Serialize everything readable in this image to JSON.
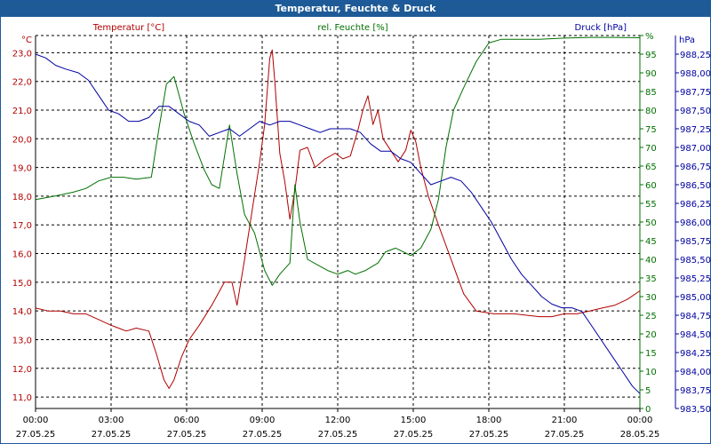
{
  "window": {
    "title": "Temperatur, Feuchte & Druck"
  },
  "chart_data": {
    "type": "line",
    "title": "Temperatur, Feuchte & Druck",
    "x_ticks": [
      {
        "time": "00:00",
        "date": "27.05.25"
      },
      {
        "time": "03:00",
        "date": "27.05.25"
      },
      {
        "time": "06:00",
        "date": "27.05.25"
      },
      {
        "time": "09:00",
        "date": "27.05.25"
      },
      {
        "time": "12:00",
        "date": "27.05.25"
      },
      {
        "time": "15:00",
        "date": "27.05.25"
      },
      {
        "time": "18:00",
        "date": "27.05.25"
      },
      {
        "time": "21:00",
        "date": "27.05.25"
      },
      {
        "time": "00:00",
        "date": "28.05.25"
      }
    ],
    "xlim_hours": [
      0,
      24
    ],
    "grid": true,
    "axes": {
      "temperature": {
        "unit": "°C",
        "ylim": [
          10.6,
          23.6
        ],
        "ticks": [
          "11,0",
          "12,0",
          "13,0",
          "14,0",
          "15,0",
          "16,0",
          "17,0",
          "18,0",
          "19,0",
          "20,0",
          "21,0",
          "22,0",
          "23,0"
        ],
        "tick_values": [
          11,
          12,
          13,
          14,
          15,
          16,
          17,
          18,
          19,
          20,
          21,
          22,
          23
        ],
        "color": "#b00000"
      },
      "humidity": {
        "unit": "%",
        "ylim": [
          0,
          100
        ],
        "ticks": [
          "0",
          "5",
          "10",
          "15",
          "20",
          "25",
          "30",
          "35",
          "40",
          "45",
          "50",
          "55",
          "60",
          "65",
          "70",
          "75",
          "80",
          "85",
          "90",
          "95",
          "%"
        ],
        "tick_values": [
          0,
          5,
          10,
          15,
          20,
          25,
          30,
          35,
          40,
          45,
          50,
          55,
          60,
          65,
          70,
          75,
          80,
          85,
          90,
          95,
          100
        ],
        "color": "#007000"
      },
      "pressure": {
        "unit": "hPa",
        "ylim": [
          983.5,
          988.5
        ],
        "ticks": [
          "983,50",
          "983,75",
          "984,00",
          "984,25",
          "984,50",
          "984,75",
          "985,00",
          "985,25",
          "985,50",
          "985,75",
          "986,00",
          "986,25",
          "986,50",
          "986,75",
          "987,00",
          "987,25",
          "987,50",
          "987,75",
          "988,00",
          "988,25"
        ],
        "tick_values": [
          983.5,
          983.75,
          984,
          984.25,
          984.5,
          984.75,
          985,
          985.25,
          985.5,
          985.75,
          986,
          986.25,
          986.5,
          986.75,
          987,
          987.25,
          987.5,
          987.75,
          988,
          988.25
        ],
        "color": "#0000a0"
      }
    },
    "series": [
      {
        "name": "Temperatur [°C]",
        "axis": "temperature",
        "color": "#b00000",
        "points": [
          [
            0,
            14.1
          ],
          [
            0.5,
            14.0
          ],
          [
            1,
            14.0
          ],
          [
            1.5,
            13.9
          ],
          [
            2,
            13.9
          ],
          [
            2.5,
            13.7
          ],
          [
            3,
            13.5
          ],
          [
            3.3,
            13.4
          ],
          [
            3.6,
            13.3
          ],
          [
            4,
            13.4
          ],
          [
            4.5,
            13.3
          ],
          [
            4.8,
            12.5
          ],
          [
            5.1,
            11.6
          ],
          [
            5.3,
            11.3
          ],
          [
            5.5,
            11.6
          ],
          [
            5.8,
            12.4
          ],
          [
            6.1,
            13.0
          ],
          [
            6.5,
            13.5
          ],
          [
            7,
            14.2
          ],
          [
            7.5,
            15.0
          ],
          [
            7.8,
            15.0
          ],
          [
            8.0,
            14.2
          ],
          [
            8.3,
            15.8
          ],
          [
            8.6,
            17.5
          ],
          [
            8.9,
            19.2
          ],
          [
            9.1,
            20.5
          ],
          [
            9.3,
            22.8
          ],
          [
            9.4,
            23.1
          ],
          [
            9.5,
            22.0
          ],
          [
            9.7,
            19.5
          ],
          [
            9.9,
            18.5
          ],
          [
            10.1,
            17.2
          ],
          [
            10.3,
            18.2
          ],
          [
            10.5,
            19.6
          ],
          [
            10.8,
            19.7
          ],
          [
            11.1,
            19.0
          ],
          [
            11.5,
            19.3
          ],
          [
            11.9,
            19.5
          ],
          [
            12.2,
            19.3
          ],
          [
            12.5,
            19.4
          ],
          [
            12.8,
            20.3
          ],
          [
            13.0,
            21.0
          ],
          [
            13.2,
            21.5
          ],
          [
            13.4,
            20.5
          ],
          [
            13.6,
            21.0
          ],
          [
            13.8,
            20.0
          ],
          [
            14.1,
            19.6
          ],
          [
            14.4,
            19.2
          ],
          [
            14.7,
            19.6
          ],
          [
            14.9,
            20.3
          ],
          [
            15.1,
            19.9
          ],
          [
            15.3,
            19.0
          ],
          [
            15.6,
            18.0
          ],
          [
            16.0,
            17.0
          ],
          [
            16.5,
            15.8
          ],
          [
            17.0,
            14.6
          ],
          [
            17.5,
            14.0
          ],
          [
            18.2,
            13.9
          ],
          [
            19,
            13.9
          ],
          [
            20,
            13.8
          ],
          [
            20.5,
            13.8
          ],
          [
            21,
            13.9
          ],
          [
            21.5,
            13.9
          ],
          [
            22,
            14.0
          ],
          [
            22.5,
            14.1
          ],
          [
            23,
            14.2
          ],
          [
            23.5,
            14.4
          ],
          [
            24,
            14.7
          ]
        ]
      },
      {
        "name": "rel. Feuchte [%]",
        "axis": "humidity",
        "color": "#007000",
        "points": [
          [
            0,
            56
          ],
          [
            0.8,
            57
          ],
          [
            1.5,
            58
          ],
          [
            2.0,
            59
          ],
          [
            2.5,
            61
          ],
          [
            3.0,
            62
          ],
          [
            3.5,
            62
          ],
          [
            4.0,
            61.5
          ],
          [
            4.6,
            62
          ],
          [
            4.9,
            75
          ],
          [
            5.2,
            87
          ],
          [
            5.5,
            89
          ],
          [
            5.9,
            79
          ],
          [
            6.3,
            71
          ],
          [
            6.7,
            64
          ],
          [
            7.0,
            60
          ],
          [
            7.3,
            59
          ],
          [
            7.7,
            76
          ],
          [
            8.0,
            63
          ],
          [
            8.3,
            52
          ],
          [
            8.7,
            47
          ],
          [
            9.1,
            37
          ],
          [
            9.4,
            33
          ],
          [
            9.7,
            36
          ],
          [
            10.1,
            39
          ],
          [
            10.3,
            60
          ],
          [
            10.5,
            50
          ],
          [
            10.8,
            40
          ],
          [
            11.2,
            38.5
          ],
          [
            11.6,
            37
          ],
          [
            12.0,
            36
          ],
          [
            12.4,
            37
          ],
          [
            12.7,
            36
          ],
          [
            13.1,
            37
          ],
          [
            13.6,
            39
          ],
          [
            13.9,
            42
          ],
          [
            14.3,
            43
          ],
          [
            14.6,
            42
          ],
          [
            14.9,
            41
          ],
          [
            15.3,
            43
          ],
          [
            15.7,
            48
          ],
          [
            16.0,
            56
          ],
          [
            16.3,
            70
          ],
          [
            16.6,
            80
          ],
          [
            17.0,
            86
          ],
          [
            17.5,
            93
          ],
          [
            18,
            98
          ],
          [
            18.5,
            99
          ],
          [
            19,
            99
          ],
          [
            20,
            99
          ],
          [
            21,
            99.3
          ],
          [
            22,
            99.5
          ],
          [
            23,
            99.5
          ],
          [
            24,
            99.4
          ]
        ]
      },
      {
        "name": "Druck [hPa]",
        "axis": "pressure",
        "color": "#0000a0",
        "points": [
          [
            0,
            988.25
          ],
          [
            0.4,
            988.2
          ],
          [
            0.8,
            988.1
          ],
          [
            1.2,
            988.05
          ],
          [
            1.7,
            988.0
          ],
          [
            2.1,
            987.9
          ],
          [
            2.5,
            987.7
          ],
          [
            2.9,
            987.5
          ],
          [
            3.3,
            987.45
          ],
          [
            3.7,
            987.35
          ],
          [
            4.1,
            987.35
          ],
          [
            4.5,
            987.4
          ],
          [
            4.9,
            987.55
          ],
          [
            5.3,
            987.55
          ],
          [
            5.7,
            987.45
          ],
          [
            6.1,
            987.35
          ],
          [
            6.5,
            987.3
          ],
          [
            6.9,
            987.15
          ],
          [
            7.3,
            987.2
          ],
          [
            7.7,
            987.25
          ],
          [
            8.1,
            987.15
          ],
          [
            8.5,
            987.25
          ],
          [
            8.9,
            987.35
          ],
          [
            9.3,
            987.3
          ],
          [
            9.7,
            987.35
          ],
          [
            10.1,
            987.35
          ],
          [
            10.5,
            987.3
          ],
          [
            10.9,
            987.25
          ],
          [
            11.3,
            987.2
          ],
          [
            11.7,
            987.25
          ],
          [
            12.1,
            987.25
          ],
          [
            12.5,
            987.25
          ],
          [
            12.9,
            987.2
          ],
          [
            13.3,
            987.05
          ],
          [
            13.7,
            986.95
          ],
          [
            14.1,
            986.95
          ],
          [
            14.5,
            986.85
          ],
          [
            14.9,
            986.8
          ],
          [
            15.3,
            986.65
          ],
          [
            15.7,
            986.5
          ],
          [
            16.1,
            986.55
          ],
          [
            16.5,
            986.6
          ],
          [
            16.9,
            986.55
          ],
          [
            17.3,
            986.4
          ],
          [
            17.7,
            986.2
          ],
          [
            18.1,
            986.0
          ],
          [
            18.5,
            985.75
          ],
          [
            18.9,
            985.5
          ],
          [
            19.3,
            985.3
          ],
          [
            19.7,
            985.15
          ],
          [
            20.1,
            985.0
          ],
          [
            20.5,
            984.9
          ],
          [
            20.9,
            984.85
          ],
          [
            21.3,
            984.85
          ],
          [
            21.7,
            984.8
          ],
          [
            22.1,
            984.6
          ],
          [
            22.5,
            984.4
          ],
          [
            22.9,
            984.2
          ],
          [
            23.3,
            984.0
          ],
          [
            23.7,
            983.8
          ],
          [
            24,
            983.7
          ]
        ]
      }
    ]
  }
}
